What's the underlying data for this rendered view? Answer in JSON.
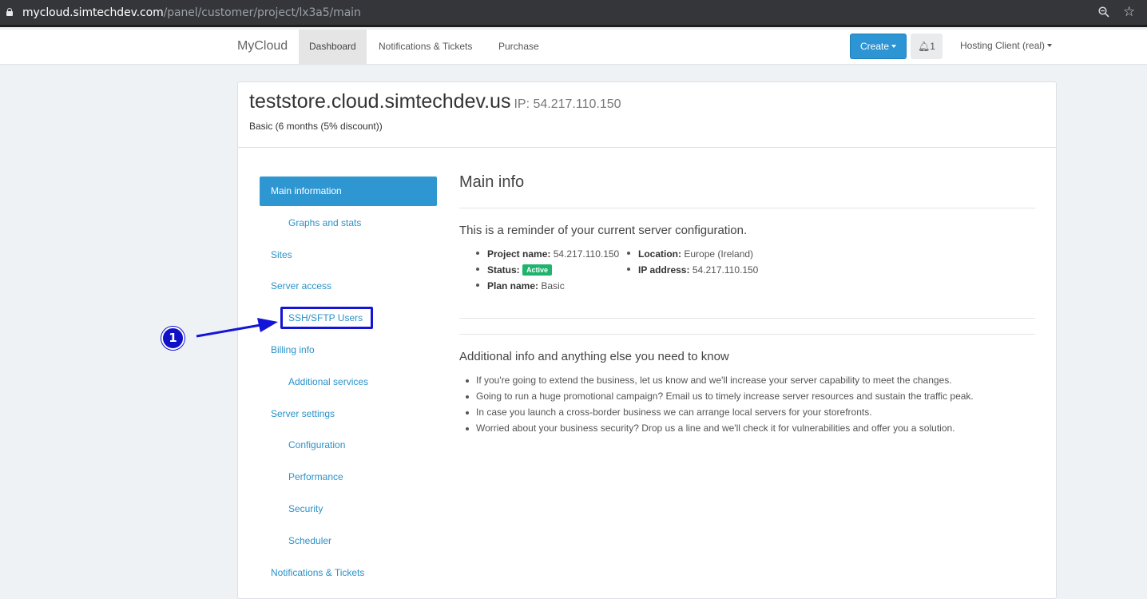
{
  "browser": {
    "url_host": "mycloud.simtechdev.com",
    "url_path": "/panel/customer/project/lx3a5/main",
    "icons": [
      "lock-icon",
      "zoom-icon",
      "star-icon"
    ]
  },
  "navbar": {
    "brand": "MyCloud",
    "items": [
      {
        "label": "Dashboard",
        "active": true
      },
      {
        "label": "Notifications & Tickets",
        "active": false
      },
      {
        "label": "Purchase",
        "active": false
      }
    ],
    "create_label": "Create",
    "notifications_count": "1",
    "user_menu": "Hosting Client (real)"
  },
  "project": {
    "title": "teststore.cloud.simtechdev.us",
    "ip_label": "IP: 54.217.110.150",
    "plan_subtitle": "Basic (6 months (5% discount))"
  },
  "side_menu": {
    "items": [
      {
        "label": "Main information",
        "level": 0,
        "active": true
      },
      {
        "label": "Graphs and stats",
        "level": 1
      },
      {
        "label": "Sites",
        "level": 0
      },
      {
        "label": "Server access",
        "level": 0
      },
      {
        "label": "SSH/SFTP Users",
        "level": 1,
        "highlighted": true
      },
      {
        "label": "Billing info",
        "level": 0
      },
      {
        "label": "Additional services",
        "level": 1
      },
      {
        "label": "Server settings",
        "level": 0
      },
      {
        "label": "Configuration",
        "level": 1
      },
      {
        "label": "Performance",
        "level": 1
      },
      {
        "label": "Security",
        "level": 1
      },
      {
        "label": "Scheduler",
        "level": 1
      },
      {
        "label": "Notifications & Tickets",
        "level": 0
      }
    ]
  },
  "main": {
    "title": "Main info",
    "reminder": "This is a reminder of your current server configuration.",
    "details_left": [
      {
        "key": "Project name:",
        "value": "54.217.110.150"
      },
      {
        "key": "Status:",
        "value": "Active"
      },
      {
        "key": "Plan name:",
        "value": "Basic"
      }
    ],
    "details_right": [
      {
        "key": "Location:",
        "value": "Europe (Ireland)"
      },
      {
        "key": "IP address:",
        "value": "54.217.110.150"
      }
    ],
    "additional_title": "Additional info and anything else you need to know",
    "additional_items": [
      "If you're going to extend the business, let us know and we'll increase your server capability to meet the changes.",
      "Going to run a huge promotional campaign? Email us to timely increase server resources and sustain the traffic peak.",
      "In case you launch a cross-border business we can arrange local servers for your storefronts.",
      "Worried about your business security? Drop us a line and we'll check it for vulnerabilities and offer you a solution."
    ]
  },
  "annotation": {
    "step_number": "1",
    "color": "#1414d9"
  },
  "colors": {
    "accent": "#2e97d2",
    "status_active": "#1fb36c",
    "link": "#2a92c9"
  }
}
